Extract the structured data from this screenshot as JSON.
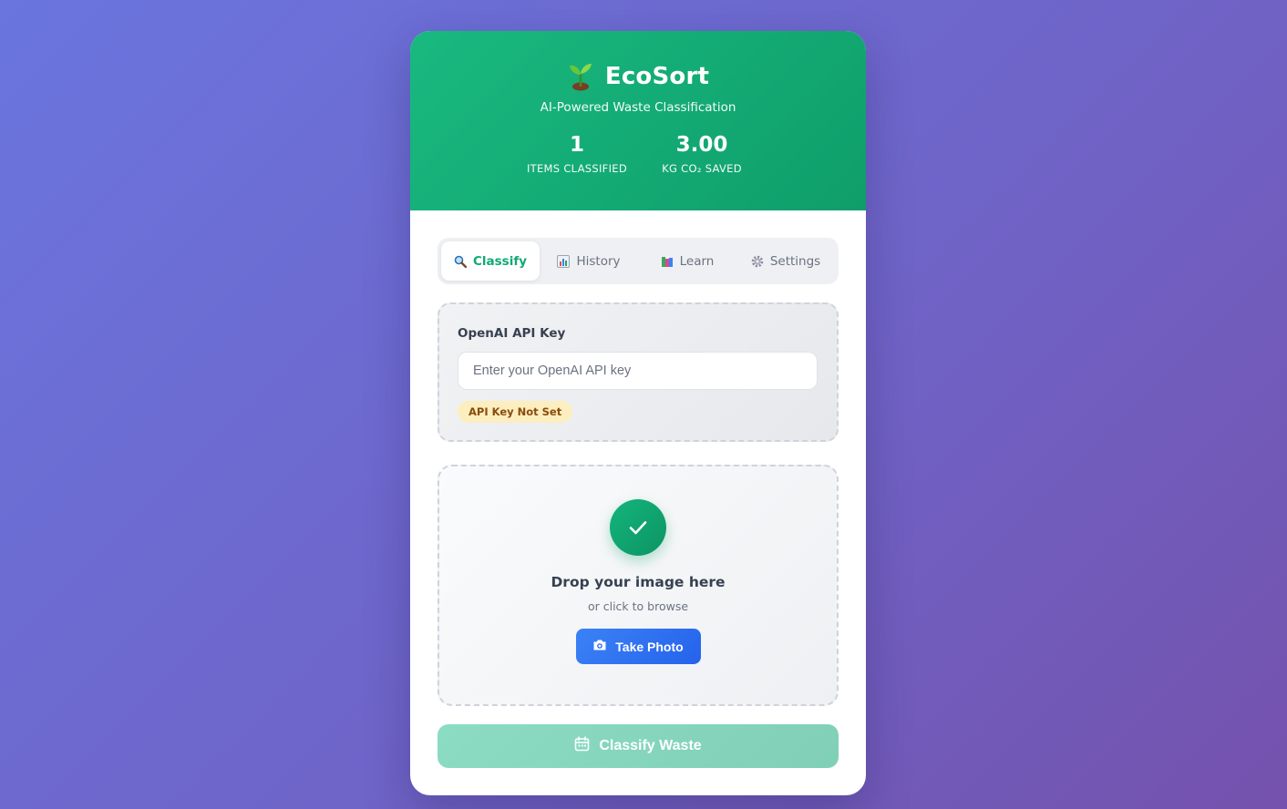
{
  "header": {
    "title": "EcoSort",
    "logo_icon": "seedling-icon",
    "subtitle": "AI-Powered Waste Classification",
    "stats": [
      {
        "value": "1",
        "label": "ITEMS CLASSIFIED"
      },
      {
        "value": "3.00",
        "label": "KG CO₂ SAVED"
      }
    ]
  },
  "tabs": [
    {
      "label": "Classify",
      "icon": "magnifier-icon",
      "active": true
    },
    {
      "label": "History",
      "icon": "bar-chart-icon",
      "active": false
    },
    {
      "label": "Learn",
      "icon": "books-icon",
      "active": false
    },
    {
      "label": "Settings",
      "icon": "gear-icon",
      "active": false
    }
  ],
  "api": {
    "label": "OpenAI API Key",
    "placeholder": "Enter your OpenAI API key",
    "value": "",
    "status": "API Key Not Set"
  },
  "upload": {
    "icon": "check-icon",
    "title": "Drop your image here",
    "subtitle": "or click to browse",
    "photo_button": "Take Photo",
    "photo_icon": "camera-icon"
  },
  "classify_button": {
    "label": "Classify Waste",
    "icon": "calendar-icon"
  },
  "colors": {
    "brand": "#12a874",
    "header_gradient": [
      "#19b980",
      "#0f9e6a"
    ],
    "primary_button": "#2563eb",
    "badge_bg": "#fdeec0",
    "badge_text": "#8a4b0a"
  }
}
